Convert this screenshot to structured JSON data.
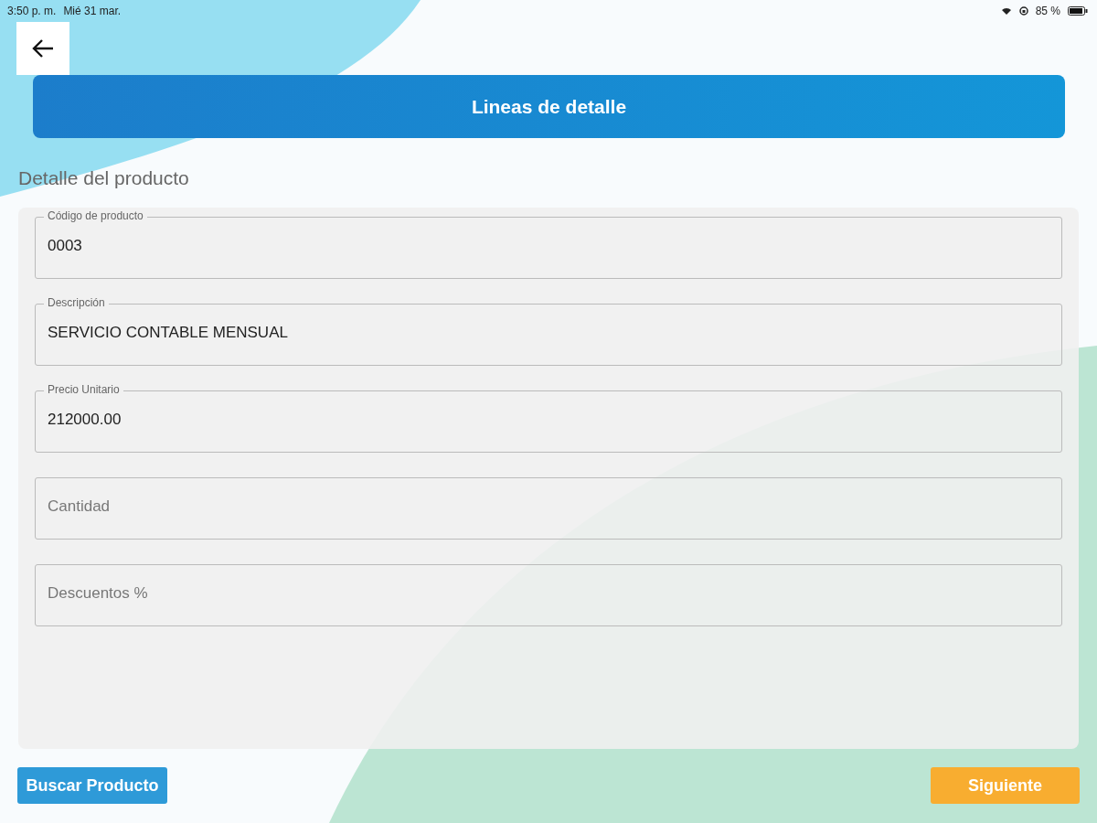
{
  "status_bar": {
    "time": "3:50 p. m.",
    "date": "Mié 31 mar.",
    "battery": "85 %"
  },
  "header": {
    "title": "Lineas de detalle"
  },
  "section_title": "Detalle del producto",
  "fields": [
    {
      "label": "Código de producto",
      "value": "0003"
    },
    {
      "label": "Descripción",
      "value": "SERVICIO CONTABLE MENSUAL"
    },
    {
      "label": "Precio Unitario",
      "value": "212000.00"
    },
    {
      "placeholder": "Cantidad"
    },
    {
      "placeholder": "Descuentos %"
    }
  ],
  "buttons": [
    {
      "label": "Buscar Producto",
      "kind": "secondary"
    },
    {
      "label": "Siguiente",
      "kind": "primary"
    }
  ]
}
